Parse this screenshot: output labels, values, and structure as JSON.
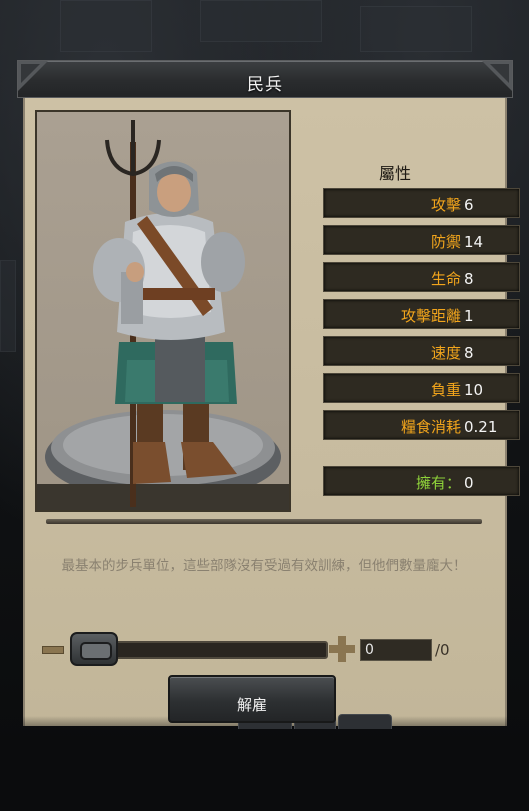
{
  "dialog": {
    "title": "民兵"
  },
  "attributes": {
    "heading": "屬性",
    "rows": [
      {
        "label": "攻擊",
        "value": "6"
      },
      {
        "label": "防禦",
        "value": "14"
      },
      {
        "label": "生命",
        "value": "8"
      },
      {
        "label": "攻擊距離",
        "value": "1"
      },
      {
        "label": "速度",
        "value": "8"
      },
      {
        "label": "負重",
        "value": "10"
      },
      {
        "label": "糧食消耗",
        "value": "0.21"
      }
    ],
    "owned": {
      "label": "擁有：",
      "value": "0"
    }
  },
  "description": "最基本的步兵單位，這些部隊沒有受過有效訓練，但他們數量龐大！",
  "quantity": {
    "value": "0",
    "max_label": "/0"
  },
  "actions": {
    "dismiss_label": "解雇"
  },
  "colors": {
    "panel": "#c7bb9f",
    "label_orange": "#f2a51c",
    "owned_green": "#8fd33a",
    "row_bg": "#2e2a21"
  }
}
